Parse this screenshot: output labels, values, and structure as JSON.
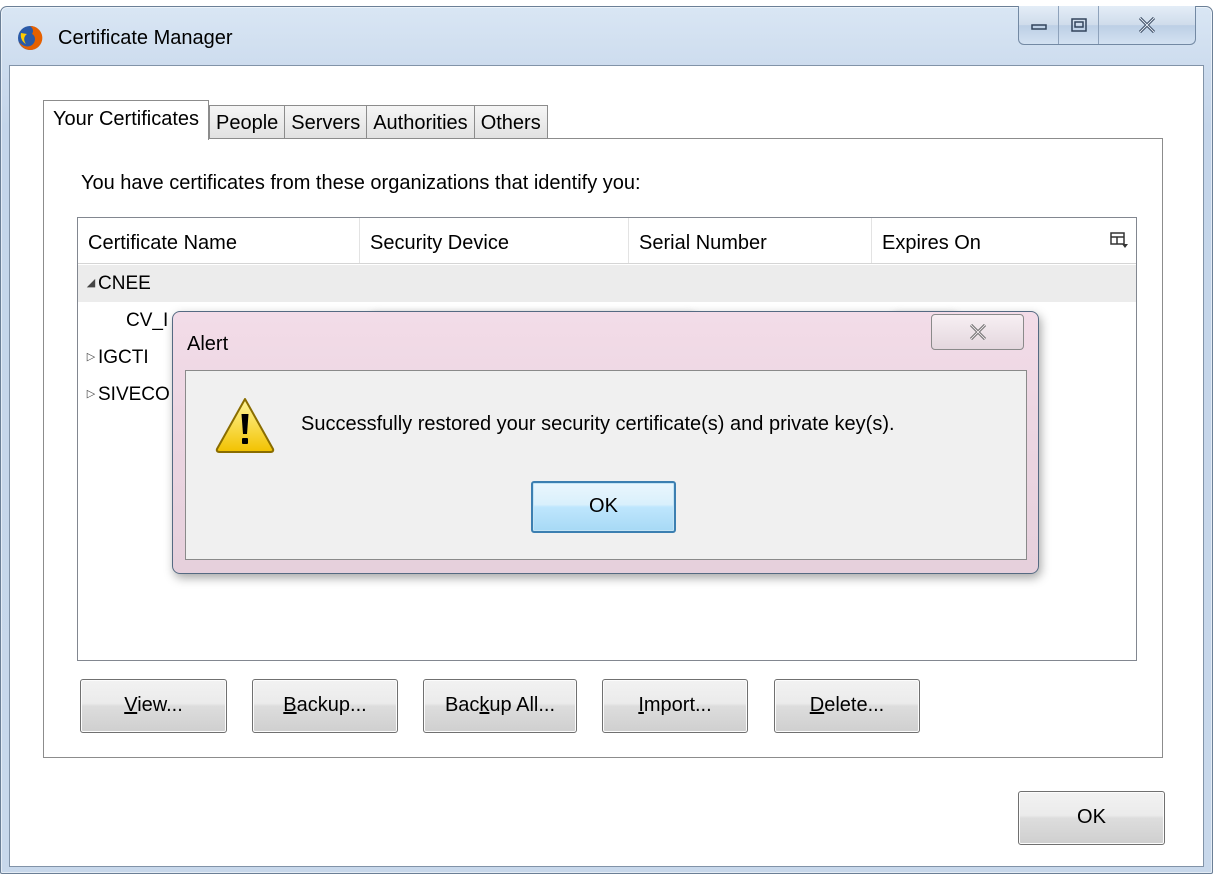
{
  "window": {
    "title": "Certificate Manager",
    "caption_minimize": "minimize",
    "caption_maximize": "maximize",
    "caption_close": "close"
  },
  "tabs": [
    {
      "label": "Your Certificates",
      "active": true
    },
    {
      "label": "People",
      "active": false
    },
    {
      "label": "Servers",
      "active": false
    },
    {
      "label": "Authorities",
      "active": false
    },
    {
      "label": "Others",
      "active": false
    }
  ],
  "intro_text": "You have certificates from these organizations that identify you:",
  "columns": [
    "Certificate Name",
    "Security Device",
    "Serial Number",
    "Expires On"
  ],
  "tree_rows": [
    {
      "twisty": "◢",
      "label": "CNEE",
      "selected": true
    },
    {
      "twisty": "",
      "label": "CV_I",
      "selected": false
    },
    {
      "twisty": "▷",
      "label": "IGCTI",
      "selected": false
    },
    {
      "twisty": "▷",
      "label": "SIVECO",
      "selected": false
    }
  ],
  "buttons": {
    "view": {
      "pre": "",
      "key": "V",
      "post": "iew..."
    },
    "backup": {
      "pre": "",
      "key": "B",
      "post": "ackup..."
    },
    "backup_all": {
      "pre": "Bac",
      "key": "k",
      "post": "up All..."
    },
    "import": {
      "pre": "",
      "key": "I",
      "post": "mport..."
    },
    "delete": {
      "pre": "",
      "key": "D",
      "post": "elete..."
    },
    "ok": "OK"
  },
  "alert": {
    "title": "Alert",
    "message": "Successfully restored your security certificate(s) and private key(s).",
    "ok": "OK",
    "icon": "warning-icon"
  },
  "colors": {
    "title_gradient_top": "#d9e6f4",
    "alert_frame": "#ecd6e2",
    "ok_default_border": "#3c7fb1"
  }
}
